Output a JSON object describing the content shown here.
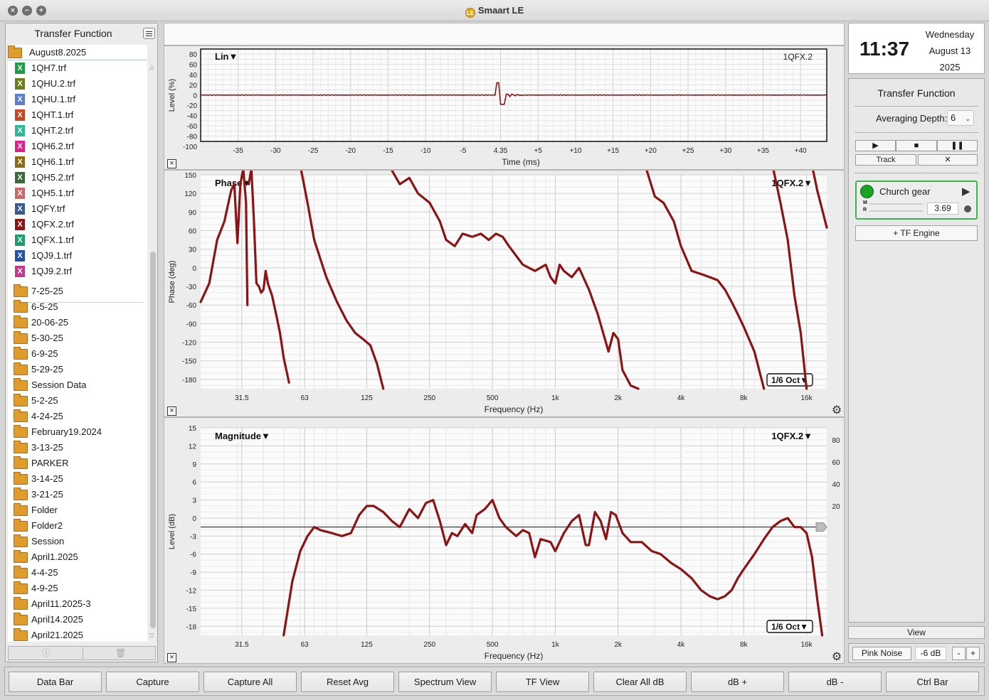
{
  "window": {
    "title": "Smaart LE",
    "logo": "LE",
    "controls": [
      "close",
      "minimize",
      "zoom"
    ]
  },
  "left_panel": {
    "title": "Transfer Function",
    "root_folder": "August8.2025",
    "files": [
      {
        "name": "1QH7.trf",
        "color": "#1e9c46"
      },
      {
        "name": "1QHU.2.trf",
        "color": "#6f7a1a"
      },
      {
        "name": "1QHU.1.trf",
        "color": "#5d7ec9"
      },
      {
        "name": "1QHT.1.trf",
        "color": "#c9451e"
      },
      {
        "name": "1QHT.2.trf",
        "color": "#2fb893"
      },
      {
        "name": "1QH6.2.trf",
        "color": "#e0218a"
      },
      {
        "name": "1QH6.1.trf",
        "color": "#8a6a12"
      },
      {
        "name": "1QH5.2.trf",
        "color": "#3b6b3b"
      },
      {
        "name": "1QH5.1.trf",
        "color": "#c76a6a"
      },
      {
        "name": "1QFY.trf",
        "color": "#3a5a8a"
      },
      {
        "name": "1QFX.2.trf",
        "color": "#8b1414"
      },
      {
        "name": "1QFX.1.trf",
        "color": "#1e9c6e"
      },
      {
        "name": "1QJ9.1.trf",
        "color": "#2450a8"
      },
      {
        "name": "1QJ9.2.trf",
        "color": "#c23a8a"
      }
    ],
    "folders": [
      "7-25-25",
      "6-5-25",
      "20-06-25",
      "5-30-25",
      "6-9-25",
      "5-29-25",
      "Session Data",
      "5-2-25",
      "4-24-25",
      "February19.2024",
      "3-13-25",
      "PARKER",
      "3-14-25",
      "3-21-25",
      "Folder",
      "Folder2",
      "Session",
      "April1.2025",
      "4-4-25",
      "4-9-25",
      "April11.2025-3",
      "April14.2025",
      "April21.2025"
    ],
    "file_icon_letter": "X",
    "footer_icons": [
      "info-icon",
      "trash-icon"
    ]
  },
  "impulse": {
    "label": "Lin▼",
    "trace": "1QFX.2",
    "y_axis_label": "Level (%)",
    "x_axis_label": "Time (ms)",
    "y_ticks": [
      "80",
      "60",
      "40",
      "20",
      "0",
      "-20",
      "-40",
      "-60",
      "-80",
      "-100"
    ],
    "x_ticks": [
      "-35",
      "-30",
      "-25",
      "-20",
      "-15",
      "-10",
      "-5",
      "4.35",
      "+5",
      "+10",
      "+15",
      "+20",
      "+25",
      "+30",
      "+35",
      "+40"
    ]
  },
  "phase": {
    "label": "Phase▼",
    "trace": "1QFX.2▼",
    "smoothing": "1/6 Oct▼",
    "y_axis_label": "Phase (deg)",
    "x_axis_label": "Frequency (Hz)",
    "y_ticks": [
      "150",
      "120",
      "90",
      "60",
      "30",
      "0",
      "-30",
      "-60",
      "-90",
      "-120",
      "-150",
      "-180"
    ],
    "x_ticks": [
      "31.5",
      "63",
      "125",
      "250",
      "500",
      "1k",
      "2k",
      "4k",
      "8k",
      "16k"
    ]
  },
  "magnitude": {
    "label": "Magnitude▼",
    "trace": "1QFX.2▼",
    "smoothing": "1/6 Oct▼",
    "y_axis_label": "Level (dB)",
    "x_axis_label": "Frequency (Hz)",
    "y_ticks": [
      "15",
      "12",
      "9",
      "6",
      "3",
      "0",
      "-3",
      "-6",
      "-9",
      "-12",
      "-15",
      "-18"
    ],
    "right_ticks": [
      "80",
      "60",
      "40",
      "20"
    ],
    "x_ticks": [
      "31.5",
      "63",
      "125",
      "250",
      "500",
      "1k",
      "2k",
      "4k",
      "8k",
      "16k"
    ]
  },
  "trace_color": "#8b1414",
  "clock": {
    "time": "11:37",
    "weekday": "Wednesday",
    "date": "August 13",
    "year": "2025"
  },
  "tf_panel": {
    "title": "Transfer Function",
    "averaging_label": "Averaging Depth:",
    "averaging_value": "6",
    "track_label": "Track",
    "engine": {
      "name": "Church gear",
      "meter_m": "M",
      "meter_r": "R",
      "value": "3.69",
      "status_color": "#19a322"
    },
    "add_engine_label": "+ TF Engine"
  },
  "view_label": "View",
  "noise": {
    "button": "Pink Noise",
    "level": "-6 dB",
    "minus": "-",
    "plus": "+"
  },
  "bottom_bar": [
    "Data Bar",
    "Capture",
    "Capture All",
    "Reset Avg",
    "Spectrum View",
    "TF View",
    "Clear All dB",
    "dB +",
    "dB -",
    "Ctrl Bar"
  ]
}
